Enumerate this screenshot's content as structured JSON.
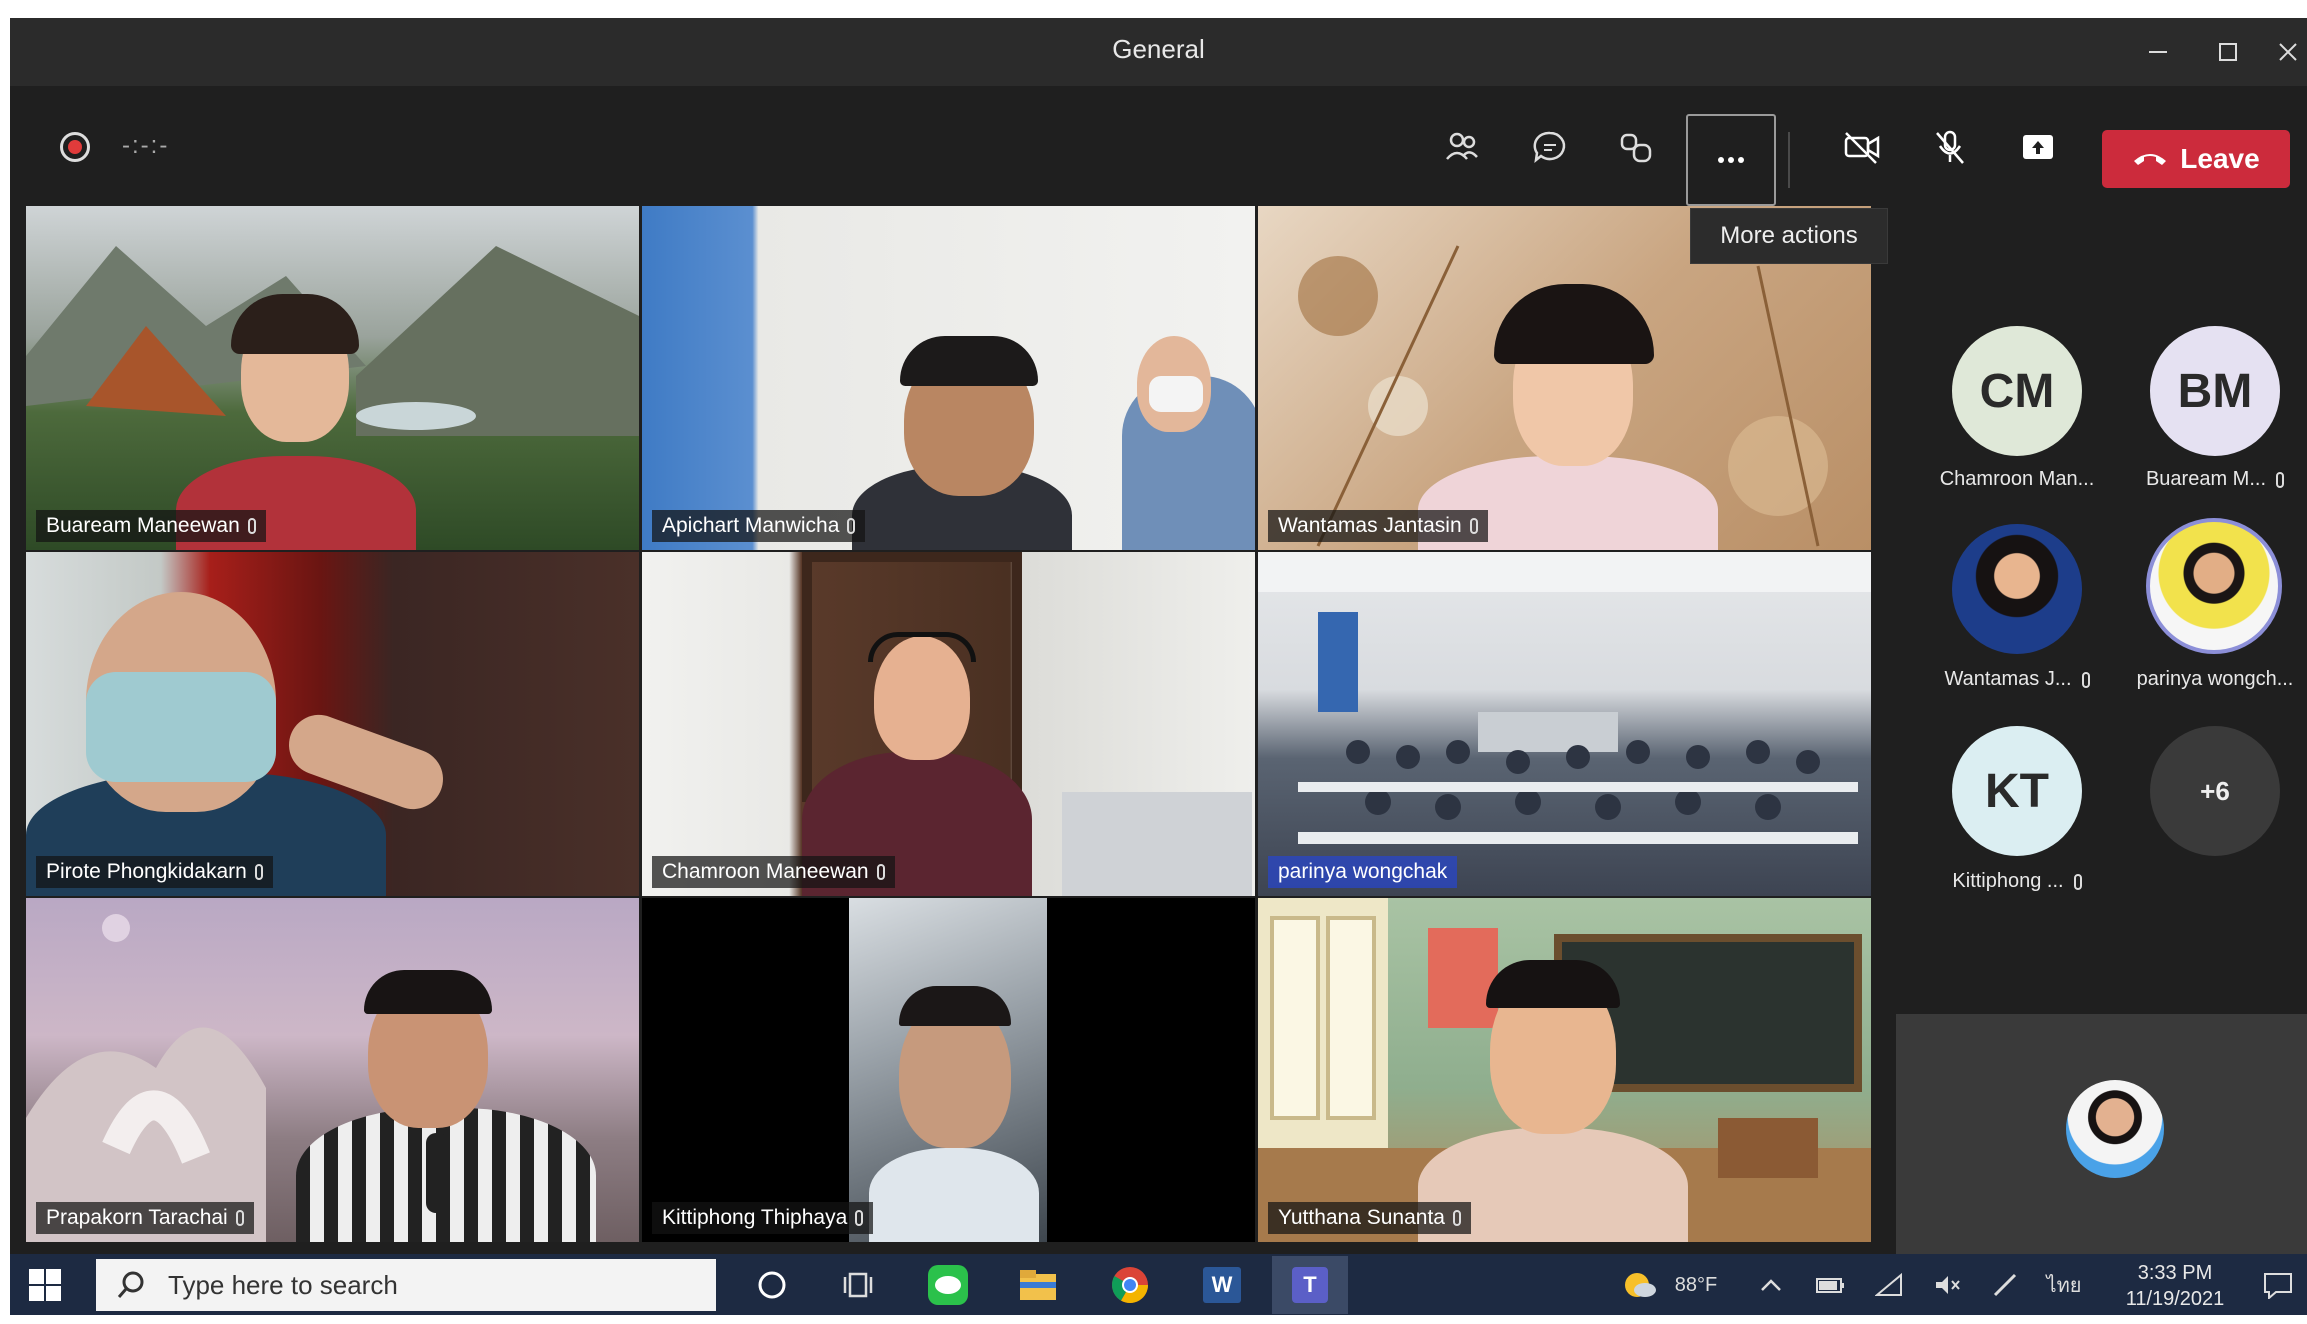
{
  "window": {
    "title": "General"
  },
  "toolbar": {
    "timer": "-:-:-",
    "more_actions_tooltip": "More actions",
    "leave_label": "Leave"
  },
  "grid": {
    "tiles": [
      {
        "name": "Buaream Maneewan"
      },
      {
        "name": "Apichart Manwicha"
      },
      {
        "name": "Wantamas Jantasin"
      },
      {
        "name": "Pirote Phongkidakarn"
      },
      {
        "name": "Chamroon Maneewan"
      },
      {
        "name": "parinya wongchak"
      },
      {
        "name": "Prapakorn Tarachai"
      },
      {
        "name": "Kittiphong Thiphaya"
      },
      {
        "name": "Yutthana Sunanta"
      }
    ]
  },
  "panel": {
    "participants": [
      {
        "initials": "CM",
        "name": "Chamroon Man..."
      },
      {
        "initials": "BM",
        "name": "Buaream M..."
      },
      {
        "initials": "",
        "name": "Wantamas J..."
      },
      {
        "initials": "",
        "name": "parinya wongch..."
      },
      {
        "initials": "KT",
        "name": "Kittiphong ..."
      }
    ],
    "overflow_count": "+6"
  },
  "taskbar": {
    "search_placeholder": "Type here to search",
    "weather": "88°F",
    "language": "ไทย",
    "time": "3:33 PM",
    "date": "11/19/2021"
  },
  "colors": {
    "leave": "#cc2b3c",
    "taskbar": "#1d2a42",
    "app_bg": "#1f1f1f"
  }
}
